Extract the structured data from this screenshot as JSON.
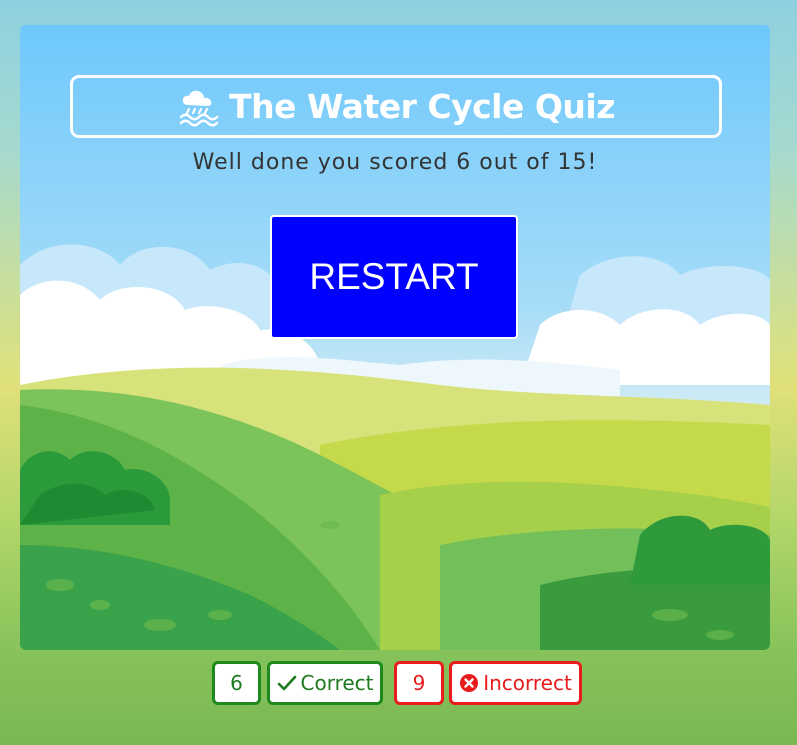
{
  "quiz": {
    "title": "The Water Cycle Quiz",
    "title_icon": "cloud-rain-icon",
    "result_message": "Well done you scored 6 out of 15!",
    "score": 6,
    "total": 15
  },
  "restart": {
    "label": "RESTART"
  },
  "tally": {
    "correct_count": "6",
    "correct_label": "Correct",
    "correct_icon": "check-icon",
    "incorrect_count": "9",
    "incorrect_label": "Incorrect",
    "incorrect_icon": "x-circle-icon"
  },
  "colors": {
    "accent_button": "#0000ff",
    "correct": "#1e8a1e",
    "incorrect": "#e81c1c",
    "sky": "#69c7fb"
  }
}
